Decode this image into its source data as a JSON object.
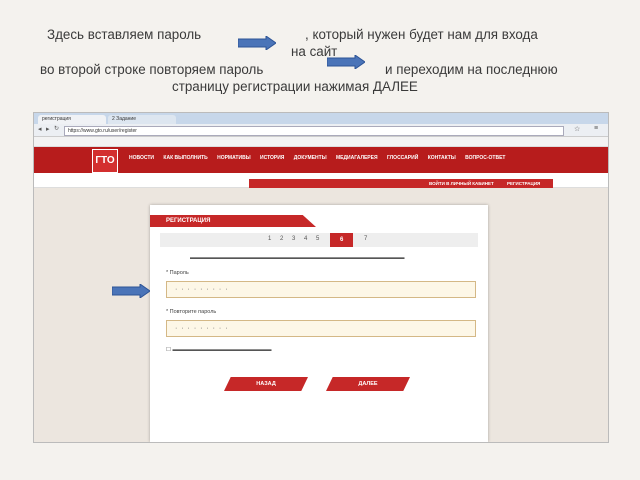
{
  "instructions": {
    "line1a": "Здесь вставляем пароль",
    "line1b": ", который нужен будет нам для входа",
    "line2": "на сайт",
    "line3a": "во второй строке повторяем пароль",
    "line3b": "и переходим на последнюю",
    "line4": "страницу регистрации нажимая ДАЛЕЕ"
  },
  "colors": {
    "arrow": "#4a74b8",
    "brand": "#c62828"
  },
  "browser": {
    "url": "https://www.gto.ru/user/register"
  },
  "site": {
    "logo": "ГТО",
    "nav": [
      "НОВОСТИ",
      "КАК ВЫПОЛНИТЬ",
      "НОРМАТИВЫ",
      "ИСТОРИЯ",
      "ДОКУМЕНТЫ",
      "МЕДИАГАЛЕРЕЯ",
      "ГЛОССАРИЙ",
      "КОНТАКТЫ",
      "ВОПРОС-ОТВЕТ"
    ],
    "login": "ВОЙТИ В ЛИЧНЫЙ КАБИНЕТ",
    "register": "РЕГИСТРАЦИЯ"
  },
  "form": {
    "title": "РЕГИСТРАЦИЯ",
    "steps": [
      "1",
      "2",
      "3",
      "4",
      "5",
      "6",
      "7"
    ],
    "active_step": "6",
    "password_label": "* Пароль",
    "password_value": "· · · · · · · · ·",
    "repeat_label": "* Повторите пароль",
    "repeat_value": "· · · · · · · · ·",
    "back_button": "НАЗАД",
    "next_button": "ДАЛЕЕ"
  }
}
